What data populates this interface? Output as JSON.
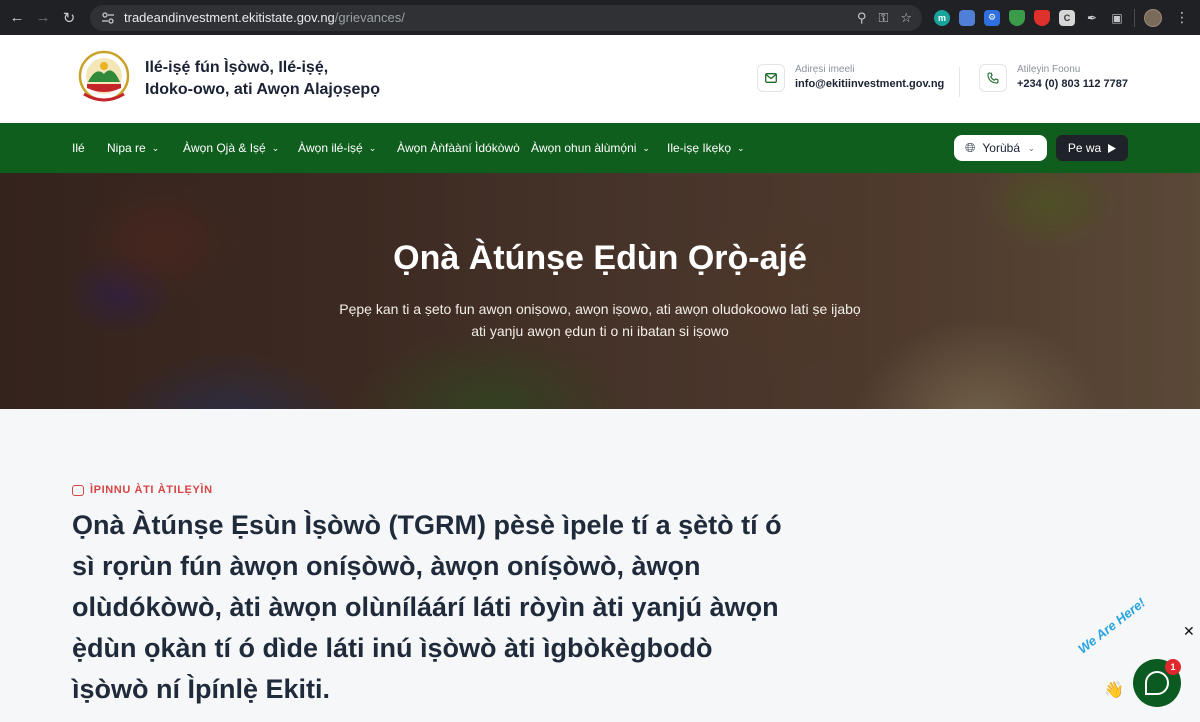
{
  "browser": {
    "url_host": "tradeandinvestment.ekitistate.gov.ng",
    "url_path": "/grievances/"
  },
  "header": {
    "title_line1": "Ilé-iṣẹ́ fún Ìṣòwò, Ilé-iṣẹ́,",
    "title_line2": "Idoko-owo, ati Awọn Alajọṣepọ",
    "email_label": "Adirẹsi imeeli",
    "email_value": "info@ekitiinvestment.gov.ng",
    "phone_label": "Atilẹyin Foonu",
    "phone_value": "+234 (0) 803 112 7787"
  },
  "nav": {
    "items": [
      {
        "label": "Ilé",
        "has_dropdown": false
      },
      {
        "label": "Nipa re",
        "has_dropdown": true
      },
      {
        "label": "Àwọn Ọjà & Iṣẹ́",
        "has_dropdown": true
      },
      {
        "label": "Àwọn ilé-iṣẹ́",
        "has_dropdown": true
      },
      {
        "label": "Àwọn Àǹfààní Ìdókòwò",
        "has_dropdown": false
      },
      {
        "label": "Àwọn ohun àlùmọ́ni",
        "has_dropdown": true
      },
      {
        "label": "Ile-iṣẹ Ikẹkọ",
        "has_dropdown": true
      }
    ],
    "language": "Yorùbá",
    "cta": "Pe wa"
  },
  "hero": {
    "title": "Ọnà Àtúnṣe Ẹdùn Ọrọ̀-ajé",
    "subtitle": "Pẹpẹ kan ti a ṣeto fun awọn oniṣowo, awọn iṣowo, ati awọn oludokoowo lati ṣe ijabọ ati yanju awọn ẹdun ti o ni ibatan si iṣowo"
  },
  "content": {
    "eyebrow": "ÌPINNU ÀTI ÀTILẸYÌN",
    "headline": "Ọnà Àtúnṣe Ẹsùn Ìṣòwò (TGRM) pèsè ìpele tí a ṣètò tí ó sì rọrùn fún àwọn oníṣòwò, àwọn oníṣòwò, àwọn olùdókòwò, àti àwọn olùníláárí láti ròyìn àti yanjú àwọn ẹ̀dùn ọkàn tí ó dìde láti inú ìṣòwò àti ìgbòkègbodò ìṣòwò ní Ìpínlẹ̀ Ekiti."
  },
  "chat": {
    "badge_text": "We Are Here!",
    "unread_count": "1"
  },
  "colors": {
    "nav_green": "#0f5e1e",
    "accent_red": "#d64545",
    "chat_green": "#0b5a22"
  }
}
